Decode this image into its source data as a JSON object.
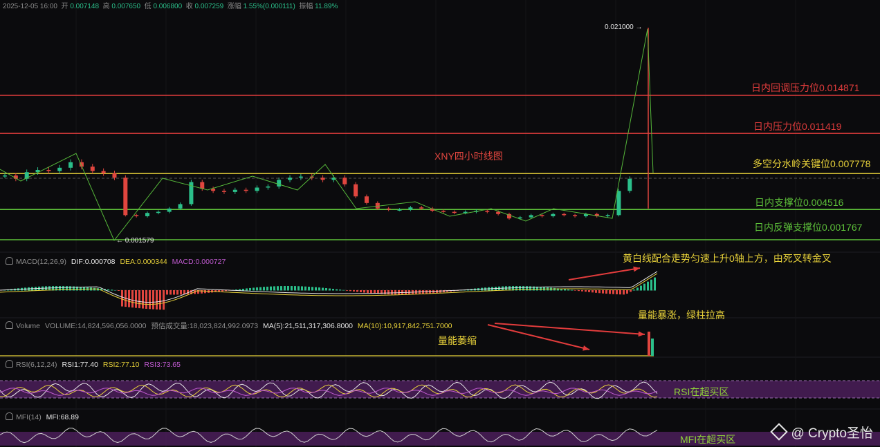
{
  "header": {
    "date": "2025-12-05 16:00",
    "open_label": "开",
    "open": "0.007148",
    "high_label": "高",
    "high": "0.007650",
    "low_label": "低",
    "low": "0.006800",
    "close_label": "收",
    "close": "0.007259",
    "change_label": "涨幅",
    "change": "1.55%(0.000111)",
    "amplitude_label": "振幅",
    "amplitude": "11.89%"
  },
  "chart_title": "XNY四小时线图",
  "price_marks": {
    "high": "0.021000",
    "low": "0.001579"
  },
  "levels": [
    {
      "label": "日内回调压力位0.014871",
      "value": 0.014871,
      "color": "#e23c3c"
    },
    {
      "label": "日内压力位0.011419",
      "value": 0.011419,
      "color": "#e23c3c"
    },
    {
      "label": "多空分水岭关键位0.007778",
      "value": 0.007778,
      "color": "#e8d23a"
    },
    {
      "label": "日内支撑位0.004516",
      "value": 0.004516,
      "color": "#5ec23a"
    },
    {
      "label": "日内反弹支撑位0.001767",
      "value": 0.001767,
      "color": "#5ec23a"
    }
  ],
  "panes": {
    "macd": {
      "name": "MACD(12,26,9)",
      "dif": "DIF:0.000708",
      "dea": "DEA:0.000344",
      "macd": "MACD:0.000727",
      "note": "黄白线配合走势匀速上升0轴上方，由死叉转金叉"
    },
    "volume": {
      "name": "Volume",
      "vol": "VOLUME:14,824,596,056.0000",
      "est": "预估成交量:18,023,824,992.0973",
      "ma5": "MA(5):21,511,317,306.8000",
      "ma10": "MA(10):10,917,842,751.7000",
      "note_low": "量能萎缩",
      "note_high": "量能暴涨，绿柱拉高"
    },
    "rsi": {
      "name": "RSI(6,12,24)",
      "rsi1": "RSI1:77.40",
      "rsi2": "RSI2:77.10",
      "rsi3": "RSI3:73.65",
      "note": "RSI在超买区"
    },
    "mfi": {
      "name": "MFI(14)",
      "mfi": "MFI:68.89",
      "note": "MFI在超买区"
    }
  },
  "watermark": "Crypto圣怡",
  "colors": {
    "up": "#2bbf8a",
    "down": "#e0463f",
    "bg": "#0b0b0d",
    "yellow": "#e8d23a",
    "purple": "#4b1e5a"
  },
  "chart_data": {
    "type": "candlestick",
    "title": "XNY四小时线图",
    "ylim": [
      0.0009,
      0.0235
    ],
    "close_series": [
      0.0076,
      0.0073,
      0.0079,
      0.0081,
      0.008,
      0.0083,
      0.0088,
      0.0084,
      0.008,
      0.0078,
      0.0074,
      0.004,
      0.0039,
      0.0042,
      0.0043,
      0.0046,
      0.005,
      0.007,
      0.0064,
      0.0062,
      0.0061,
      0.0063,
      0.0062,
      0.0065,
      0.0066,
      0.0072,
      0.0074,
      0.0075,
      0.0074,
      0.0072,
      0.0074,
      0.0068,
      0.0057,
      0.0051,
      0.0046,
      0.0045,
      0.0045,
      0.0047,
      0.0046,
      0.0044,
      0.0043,
      0.0042,
      0.0043,
      0.0044,
      0.0043,
      0.0041,
      0.0037,
      0.0038,
      0.004,
      0.0039,
      0.0041,
      0.004,
      0.0039,
      0.0041,
      0.0039,
      0.004,
      0.0062,
      0.0073
    ],
    "high": 0.021,
    "low": 0.001579,
    "rsi_overbought_zone": [
      70,
      80
    ],
    "mfi_overbought_zone": [
      80,
      90
    ]
  }
}
